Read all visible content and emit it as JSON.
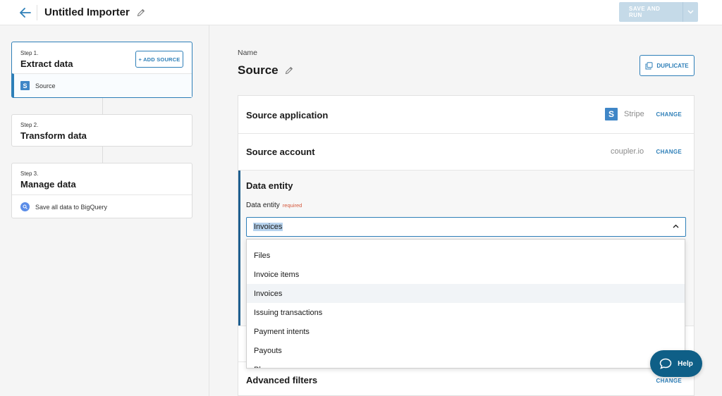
{
  "header": {
    "title": "Untitled Importer",
    "save_label": "SAVE AND RUN"
  },
  "sidebar": {
    "steps": [
      {
        "step": "Step 1.",
        "title": "Extract data",
        "action": "+ ADD SOURCE",
        "substep": "Source"
      },
      {
        "step": "Step 2.",
        "title": "Transform data"
      },
      {
        "step": "Step 3.",
        "title": "Manage data",
        "substep": "Save all data to BigQuery"
      }
    ]
  },
  "main": {
    "name_label": "Name",
    "name_value": "Source",
    "duplicate_label": "DUPLICATE",
    "rows": {
      "source_application": {
        "title": "Source application",
        "value": "Stripe",
        "change": "CHANGE"
      },
      "source_account": {
        "title": "Source account",
        "value": "coupler.io",
        "change": "CHANGE"
      },
      "advanced_filters": {
        "title": "Advanced filters",
        "change": "CHANGE"
      }
    },
    "data_entity": {
      "section_title": "Data entity",
      "field_label": "Data entity",
      "required": "required",
      "selected": "Invoices",
      "options": [
        "Files",
        "Invoice items",
        "Invoices",
        "Issuing transactions",
        "Payment intents",
        "Payouts",
        "Pl..."
      ]
    }
  },
  "help": {
    "label": "Help"
  },
  "colors": {
    "accent": "#2e7fb8",
    "help_bg": "#0f5f87",
    "required": "#d4563a"
  }
}
